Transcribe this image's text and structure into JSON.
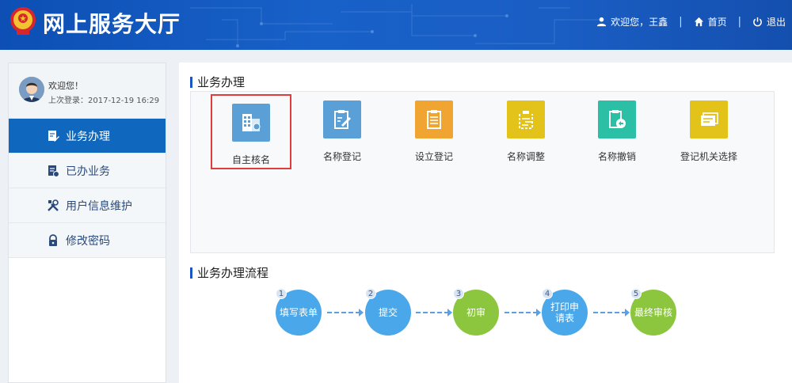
{
  "header": {
    "title": "网上服务大厅",
    "welcome_label": "欢迎您，王鑫",
    "home_label": "首页",
    "logout_label": "退出",
    "separator": "|"
  },
  "sidebar": {
    "welcome": "欢迎您！",
    "last_login": "上次登录：2017-12-19 16:29",
    "items": [
      {
        "label": "业务办理",
        "icon": "edit-document-icon",
        "active": true
      },
      {
        "label": "已办业务",
        "icon": "document-check-icon",
        "active": false
      },
      {
        "label": "用户信息维护",
        "icon": "tools-icon",
        "active": false
      },
      {
        "label": "修改密码",
        "icon": "lock-icon",
        "active": false
      }
    ]
  },
  "main": {
    "services_title": "业务办理",
    "services": [
      {
        "label": "自主核名",
        "icon": "building-name-icon",
        "color": "#5a9fd6",
        "selected": true
      },
      {
        "label": "名称登记",
        "icon": "clipboard-edit-icon",
        "color": "#5a9fd6",
        "selected": false
      },
      {
        "label": "设立登记",
        "icon": "clipboard-list-icon",
        "color": "#f0a532",
        "selected": false
      },
      {
        "label": "名称调整",
        "icon": "clipboard-adjust-icon",
        "color": "#e3c21a",
        "selected": false
      },
      {
        "label": "名称撤销",
        "icon": "clipboard-undo-icon",
        "color": "#2bbfa5",
        "selected": false
      },
      {
        "label": "登记机关选择",
        "icon": "cards-icon",
        "color": "#e3c21a",
        "selected": false
      }
    ],
    "flow_title": "业务办理流程",
    "flow_steps": [
      {
        "num": "1",
        "label": "填写表单",
        "color": "#4aa8ea"
      },
      {
        "num": "2",
        "label": "提交",
        "color": "#4aa8ea"
      },
      {
        "num": "3",
        "label": "初审",
        "color": "#8cc63f"
      },
      {
        "num": "4",
        "label": "打印申请表",
        "color": "#4aa8ea"
      },
      {
        "num": "5",
        "label": "最终审核",
        "color": "#8cc63f"
      }
    ]
  },
  "colors": {
    "header_bg": "#1861c8",
    "active_menu": "#0f68bd",
    "highlight_border": "#e23b3b"
  }
}
